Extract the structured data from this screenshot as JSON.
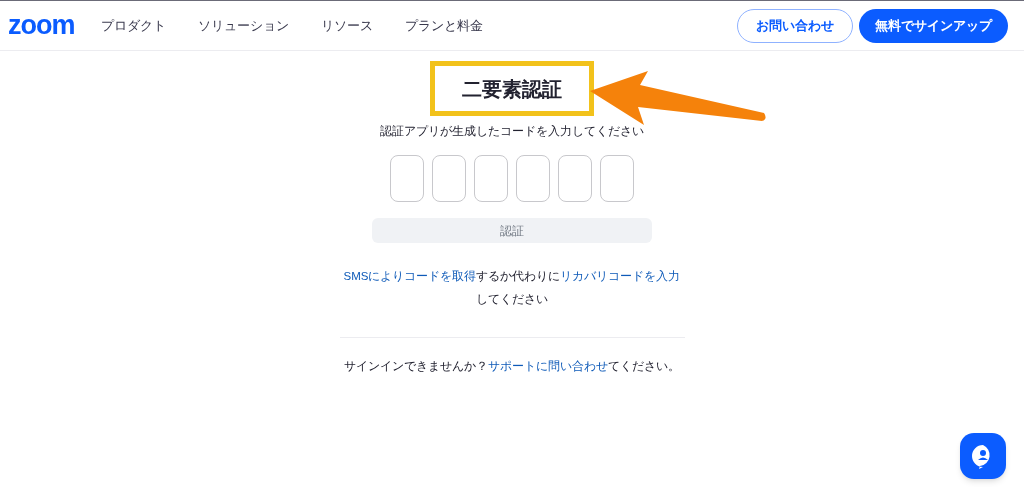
{
  "header": {
    "logo": "zoom",
    "nav": [
      "プロダクト",
      "ソリューション",
      "リソース",
      "プランと料金"
    ],
    "contact_button": "お問い合わせ",
    "signup_button": "無料でサインアップ"
  },
  "main": {
    "title": "二要素認証",
    "instruction": "認証アプリが生成したコードを入力してください",
    "verify_button": {
      "label": "認証",
      "disabled": true
    },
    "alternatives": [
      {
        "text": "SMSによりコードを取得",
        "link": true
      },
      {
        "text": "するか代わりに",
        "link": false
      },
      {
        "text": "リカバリコードを入力",
        "link": true
      },
      {
        "text": "してください",
        "link": false
      }
    ],
    "support": [
      {
        "text": "サインインできませんか？",
        "link": false
      },
      {
        "text": "サポートに問い合わせ",
        "link": true
      },
      {
        "text": "てください。",
        "link": false
      }
    ]
  }
}
